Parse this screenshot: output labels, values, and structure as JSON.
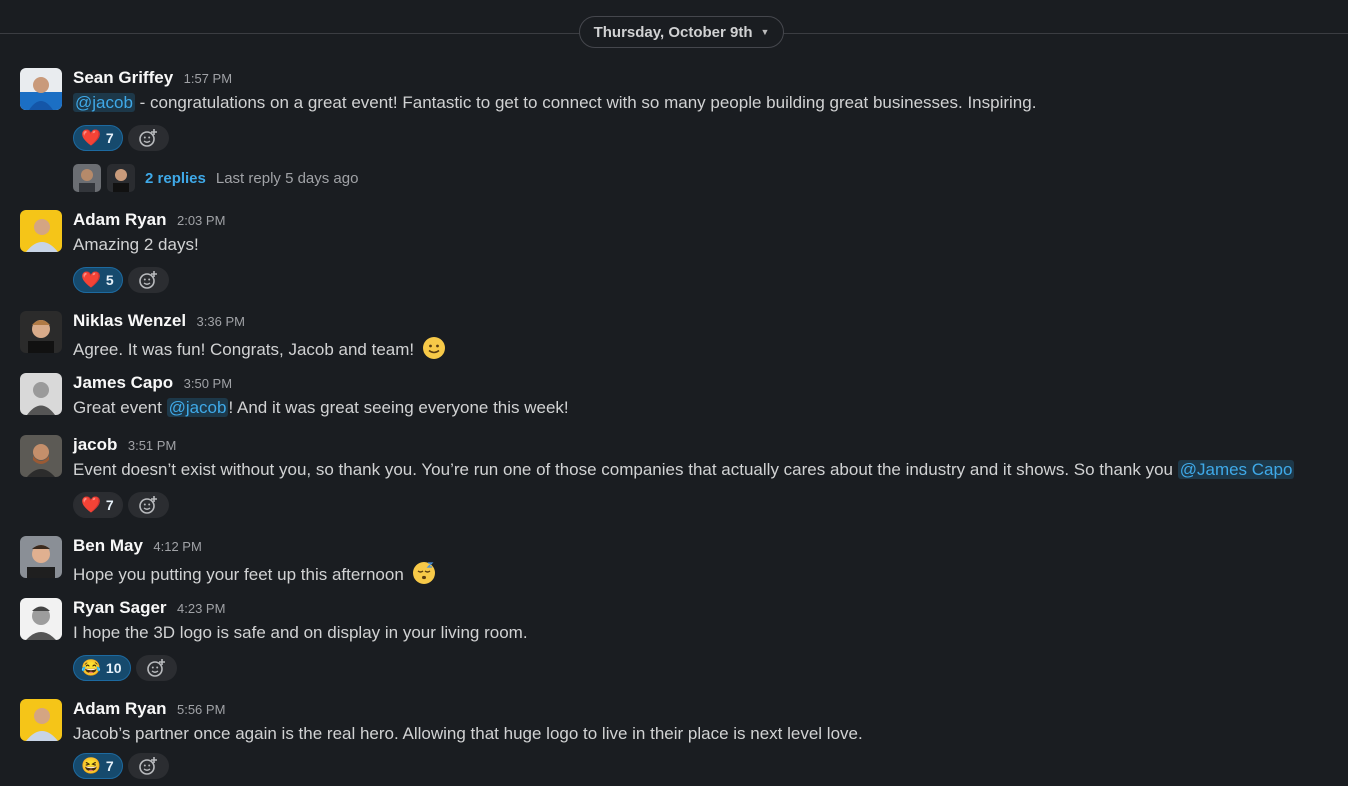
{
  "date_divider": {
    "label": "Thursday, October 9th"
  },
  "messages": [
    {
      "author": "Sean Griffey",
      "time": "1:57 PM",
      "mention": "@jacob",
      "text_after": " - congratulations on a great event!  Fantastic to get to connect with so many people building great businesses.  Inspiring.",
      "reaction": {
        "emoji": "❤️",
        "count": "7"
      },
      "thread": {
        "replies": "2 replies",
        "last_reply": "Last reply 5 days ago"
      }
    },
    {
      "author": "Adam Ryan",
      "time": "2:03 PM",
      "text": "Amazing 2 days!",
      "reaction": {
        "emoji": "❤️",
        "count": "5"
      }
    },
    {
      "author": "Niklas Wenzel",
      "time": "3:36 PM",
      "text": "Agree. It was fun! Congrats, Jacob and team!",
      "inline_emoji": "slightly-smiling-face-icon"
    },
    {
      "author": "James Capo",
      "time": "3:50 PM",
      "text_before": "Great event ",
      "mention": "@jacob",
      "text_after": "! And it was great seeing everyone this week!"
    },
    {
      "author": "jacob",
      "time": "3:51 PM",
      "text_before": "Event doesn’t exist without you, so thank you. You’re run one of those companies that actually cares about the industry and it shows. So thank you ",
      "mention": "@James Capo",
      "reaction": {
        "emoji": "❤️",
        "count": "7"
      }
    },
    {
      "author": "Ben May",
      "time": "4:12 PM",
      "text": "Hope you putting your feet up this afternoon",
      "inline_emoji": "sleeping-face-icon"
    },
    {
      "author": "Ryan Sager",
      "time": "4:23 PM",
      "text": "I hope the 3D logo is safe and on display in your living room.",
      "reaction": {
        "emoji": "😂",
        "count": "10"
      }
    },
    {
      "author": "Adam Ryan",
      "time": "5:56 PM",
      "text": "Jacob’s partner once again is the real hero. Allowing that huge logo to live in their place is next level love.",
      "reaction": {
        "emoji": "😆",
        "count": "7"
      }
    }
  ],
  "colors": {
    "background": "#1a1d21",
    "mention": "#3fa9e8",
    "reaction_bg": "#164a6d",
    "link": "#3fa9e8"
  }
}
